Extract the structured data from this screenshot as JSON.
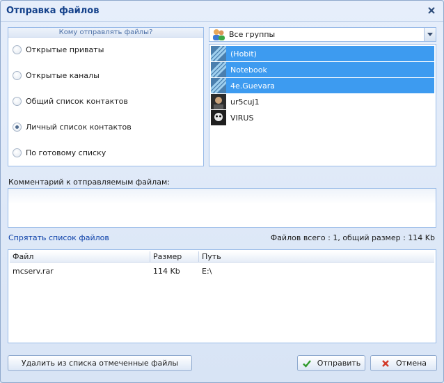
{
  "window": {
    "title": "Отправка файлов"
  },
  "recipients": {
    "header": "Кому отправлять файлы?",
    "options": [
      {
        "label": "Открытые приваты",
        "checked": false
      },
      {
        "label": "Открытые каналы",
        "checked": false
      },
      {
        "label": "Общий список контактов",
        "checked": false
      },
      {
        "label": "Личный список контактов",
        "checked": true
      },
      {
        "label": "По готовому списку",
        "checked": false
      }
    ]
  },
  "group_select": {
    "selected": "Все группы"
  },
  "contacts": [
    {
      "name": "(Hobit)",
      "selected": true
    },
    {
      "name": "Notebook",
      "selected": true
    },
    {
      "name": "4e.Guevara",
      "selected": true
    },
    {
      "name": "ur5cuj1",
      "selected": false
    },
    {
      "name": "VIRUS",
      "selected": false
    }
  ],
  "comment": {
    "label": "Комментарий к отправляемым файлам:",
    "value": ""
  },
  "files": {
    "toggle_link": "Спрятать список файлов",
    "summary": "Файлов всего : 1, общий размер : 114 Kb",
    "columns": [
      "Файл",
      "Размер",
      "Путь"
    ],
    "rows": [
      {
        "file": "mcserv.rar",
        "size": "114 Kb",
        "path": "E:\\"
      }
    ]
  },
  "buttons": {
    "remove": "Удалить из списка отмеченные файлы",
    "send": "Отправить",
    "cancel": "Отмена"
  },
  "colors": {
    "selection": "#3d9bf0",
    "title": "#15428b",
    "link": "#0b3fa8"
  }
}
